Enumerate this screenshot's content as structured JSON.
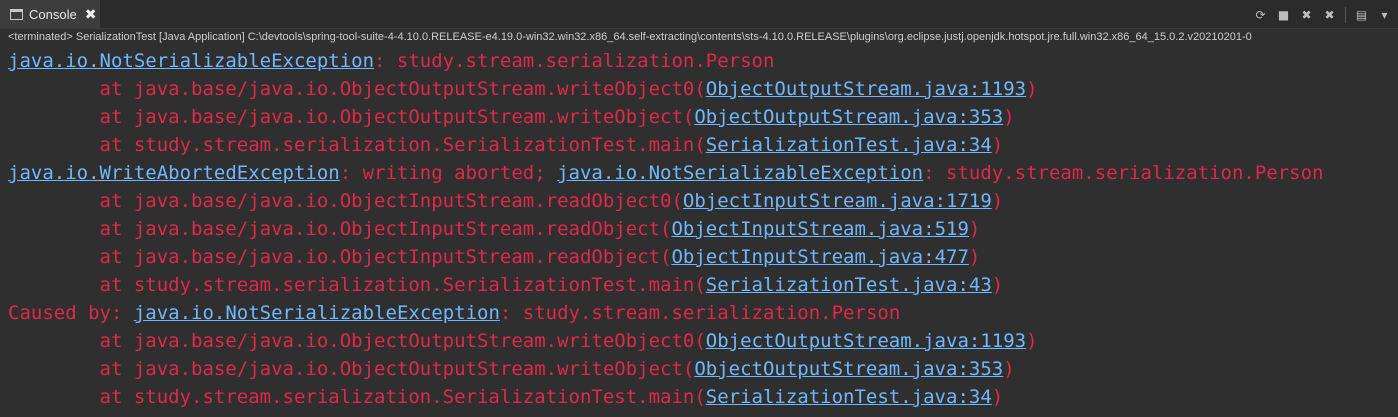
{
  "tab": {
    "label": "Console",
    "close": "✖"
  },
  "toolbar": {
    "icons": [
      "refresh-icon",
      "stop-icon",
      "remove-icon",
      "remove-all-icon",
      "clear-icon",
      "scroll-lock-icon"
    ],
    "glyphs": [
      "⟳",
      "■",
      "✖",
      "✖",
      "▤",
      "▾"
    ]
  },
  "status": {
    "text": "<terminated> SerializationTest [Java Application] C:\\devtools\\spring-tool-suite-4-4.10.0.RELEASE-e4.19.0-win32.win32.x86_64.self-extracting\\contents\\sts-4.10.0.RELEASE\\plugins\\org.eclipse.justj.openjdk.hotspot.jre.full.win32.x86_64_15.0.2.v20210201-0"
  },
  "colors": {
    "error": "#e0284a",
    "link": "#6fb8ff",
    "background": "#2f2f2f"
  },
  "lines": [
    {
      "segments": [
        {
          "t": "java.io.NotSerializableException",
          "link": true
        },
        {
          "t": ": study.stream.serialization.Person"
        }
      ]
    },
    {
      "segments": [
        {
          "t": "        at java.base/java.io.ObjectOutputStream.writeObject0("
        },
        {
          "t": "ObjectOutputStream.java:1193",
          "link": true
        },
        {
          "t": ")"
        }
      ]
    },
    {
      "segments": [
        {
          "t": "        at java.base/java.io.ObjectOutputStream.writeObject("
        },
        {
          "t": "ObjectOutputStream.java:353",
          "link": true
        },
        {
          "t": ")"
        }
      ]
    },
    {
      "segments": [
        {
          "t": "        at study.stream.serialization.SerializationTest.main("
        },
        {
          "t": "SerializationTest.java:34",
          "link": true
        },
        {
          "t": ")"
        }
      ]
    },
    {
      "segments": [
        {
          "t": "java.io.WriteAbortedException",
          "link": true
        },
        {
          "t": ": writing aborted; "
        },
        {
          "t": "java.io.NotSerializableException",
          "link": true
        },
        {
          "t": ": study.stream.serialization.Person"
        }
      ]
    },
    {
      "segments": [
        {
          "t": "        at java.base/java.io.ObjectInputStream.readObject0("
        },
        {
          "t": "ObjectInputStream.java:1719",
          "link": true
        },
        {
          "t": ")"
        }
      ]
    },
    {
      "segments": [
        {
          "t": "        at java.base/java.io.ObjectInputStream.readObject("
        },
        {
          "t": "ObjectInputStream.java:519",
          "link": true
        },
        {
          "t": ")"
        }
      ]
    },
    {
      "segments": [
        {
          "t": "        at java.base/java.io.ObjectInputStream.readObject("
        },
        {
          "t": "ObjectInputStream.java:477",
          "link": true
        },
        {
          "t": ")"
        }
      ]
    },
    {
      "segments": [
        {
          "t": "        at study.stream.serialization.SerializationTest.main("
        },
        {
          "t": "SerializationTest.java:43",
          "link": true
        },
        {
          "t": ")"
        }
      ]
    },
    {
      "segments": [
        {
          "t": "Caused by: "
        },
        {
          "t": "java.io.NotSerializableException",
          "link": true
        },
        {
          "t": ": study.stream.serialization.Person"
        }
      ]
    },
    {
      "segments": [
        {
          "t": "        at java.base/java.io.ObjectOutputStream.writeObject0("
        },
        {
          "t": "ObjectOutputStream.java:1193",
          "link": true
        },
        {
          "t": ")"
        }
      ]
    },
    {
      "segments": [
        {
          "t": "        at java.base/java.io.ObjectOutputStream.writeObject("
        },
        {
          "t": "ObjectOutputStream.java:353",
          "link": true
        },
        {
          "t": ")"
        }
      ]
    },
    {
      "segments": [
        {
          "t": "        at study.stream.serialization.SerializationTest.main("
        },
        {
          "t": "SerializationTest.java:34",
          "link": true
        },
        {
          "t": ")"
        }
      ]
    }
  ]
}
